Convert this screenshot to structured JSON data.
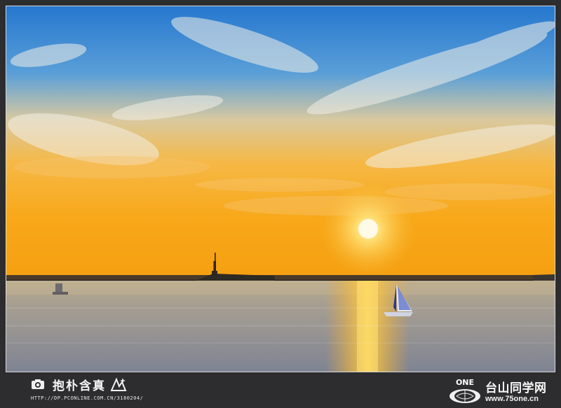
{
  "watermark": {
    "title": "抱朴含真",
    "url": "HTTP://DP.PCONLINE.COM.CN/3180204/"
  },
  "site": {
    "logo_text": "ONE",
    "name": "台山同学网",
    "url": "www.75one.cn"
  },
  "colors": {
    "sky_top": "#2f7fd0",
    "sky_mid": "#9fc3e0",
    "horizon_glow": "#f8b21e",
    "water": "#8f8f96",
    "sun": "#fff6c8",
    "frame_bg": "#2d2d2f"
  }
}
